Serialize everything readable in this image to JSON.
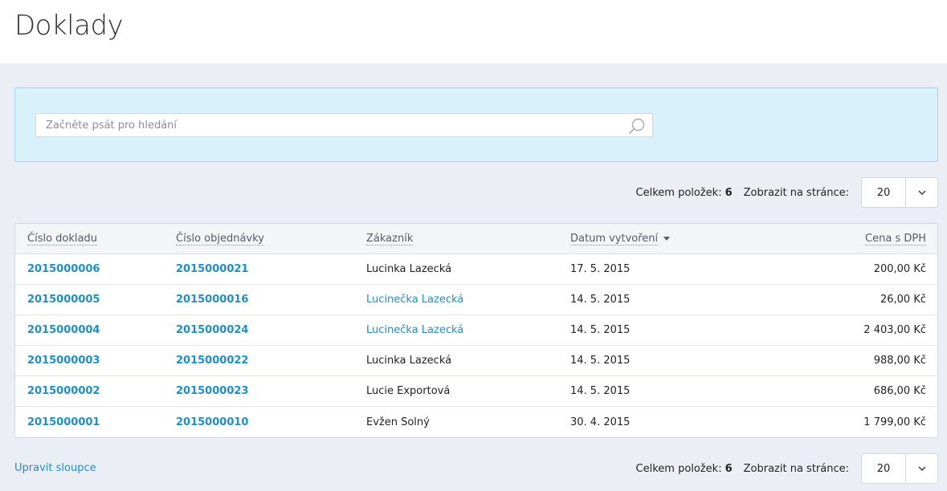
{
  "header": {
    "title": "Doklady"
  },
  "search": {
    "placeholder": "Začněte psát pro hledání",
    "value": ""
  },
  "pager": {
    "total_label": "Celkem položek:",
    "total_count": "6",
    "per_page_label": "Zobrazit na stránce:",
    "per_page_value": "20"
  },
  "table": {
    "columns": [
      "Číslo dokladu",
      "Číslo objednávky",
      "Zákazník",
      "Datum vytvoření",
      "Cena s DPH"
    ],
    "rows": [
      {
        "doc": "2015000006",
        "order": "2015000021",
        "customer": "Lucinka Lazecká",
        "customer_link": false,
        "date": "17. 5. 2015",
        "price": "200,00 Kč"
      },
      {
        "doc": "2015000005",
        "order": "2015000016",
        "customer": "Lucinečka Lazecká",
        "customer_link": true,
        "date": "14. 5. 2015",
        "price": "26,00 Kč"
      },
      {
        "doc": "2015000004",
        "order": "2015000024",
        "customer": "Lucinečka Lazecká",
        "customer_link": true,
        "date": "14. 5. 2015",
        "price": "2 403,00 Kč"
      },
      {
        "doc": "2015000003",
        "order": "2015000022",
        "customer": "Lucinka Lazecká",
        "customer_link": false,
        "date": "14. 5. 2015",
        "price": "988,00 Kč"
      },
      {
        "doc": "2015000002",
        "order": "2015000023",
        "customer": "Lucie Exportová",
        "customer_link": false,
        "date": "14. 5. 2015",
        "price": "686,00 Kč"
      },
      {
        "doc": "2015000001",
        "order": "2015000010",
        "customer": "Evžen Solný",
        "customer_link": false,
        "date": "30. 4. 2015",
        "price": "1 799,00 Kč"
      }
    ]
  },
  "footer": {
    "edit_columns_label": "Upravit sloupce"
  },
  "colors": {
    "accent": "#1e8fc6",
    "search_panel_bg": "#d9f1fb",
    "page_bg": "#eceef5"
  }
}
